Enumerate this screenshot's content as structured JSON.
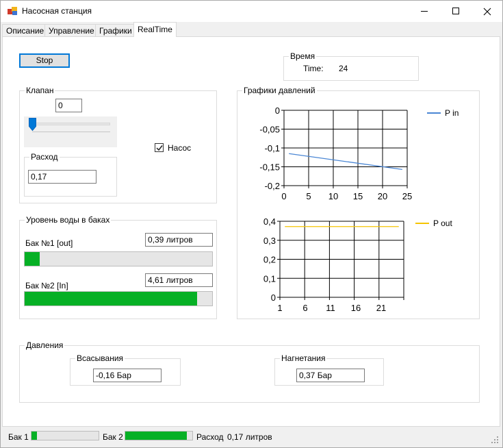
{
  "window": {
    "title": "Насосная станция"
  },
  "tabs": [
    "Описание",
    "Управление",
    "Графики",
    "RealTime"
  ],
  "stop_button": "Stop",
  "time_group": {
    "title": "Время",
    "label": "Time:",
    "value": "24"
  },
  "valve_group": {
    "title": "Клапан",
    "value": "0",
    "slider_value": 0,
    "flow_group": {
      "title": "Расход",
      "value": "0,17"
    },
    "pump": {
      "label": "Насос",
      "checked": true
    }
  },
  "tanks_group": {
    "title": "Уровень воды в баках",
    "tank1": {
      "label": "Бак №1 [out]",
      "value": "0,39 литров",
      "fill_percent": 8
    },
    "tank2": {
      "label": "Бак №2 [In]",
      "value": "4,61 литров",
      "fill_percent": 92
    }
  },
  "pressure_group": {
    "title": "Давления",
    "suction": {
      "title": "Всасывания",
      "value": "-0,16 Бар"
    },
    "discharge": {
      "title": "Нагнетания",
      "value": "0,37 Бар"
    }
  },
  "charts_group": {
    "title": "Графики давлений"
  },
  "chart_data": [
    {
      "type": "line",
      "series": [
        {
          "name": "P in",
          "color": "#4a86d4",
          "x": [
            1,
            24
          ],
          "y": [
            -0.115,
            -0.157
          ]
        }
      ],
      "xlim": [
        0,
        25
      ],
      "ylim": [
        -0.2,
        0
      ],
      "xticks": [
        "0",
        "5",
        "10",
        "15",
        "20",
        "25"
      ],
      "yticks": [
        "0",
        "-0,05",
        "-0,1",
        "-0,15",
        "-0,2"
      ],
      "grid": true,
      "legend": "top-right"
    },
    {
      "type": "line",
      "series": [
        {
          "name": "P out",
          "color": "#f5c400",
          "x": [
            1,
            24
          ],
          "y": [
            0.372,
            0.372
          ]
        }
      ],
      "xlim": [
        0,
        25
      ],
      "ylim": [
        0,
        0.4
      ],
      "xticks": [
        "1",
        "6",
        "11",
        "16",
        "21"
      ],
      "yticks": [
        "0,4",
        "0,3",
        "0,2",
        "0,1",
        "0"
      ],
      "grid": true,
      "legend": "top-right"
    }
  ],
  "statusbar": {
    "tank1_label": "Бак 1",
    "tank1_percent": 8,
    "tank2_label": "Бак 2",
    "tank2_percent": 92,
    "flow_label": "Расход",
    "flow_value": "0,17 литров"
  }
}
